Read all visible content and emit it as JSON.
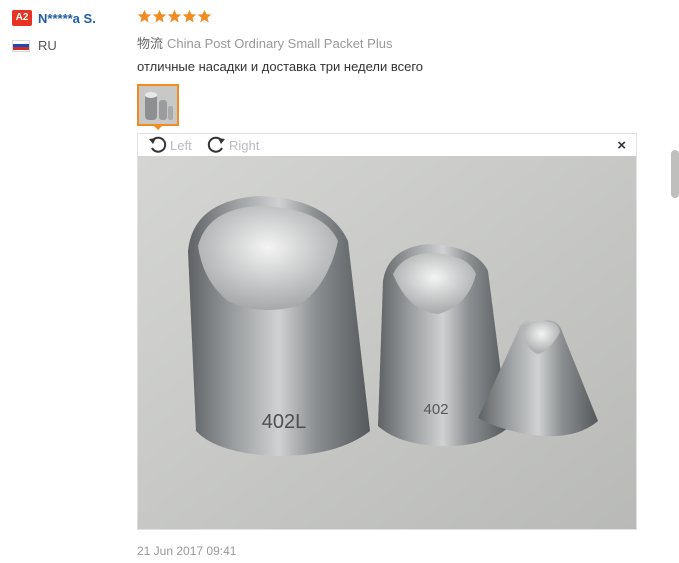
{
  "buyer": {
    "level_badge": "A2",
    "name": "N*****a S.",
    "country": "RU",
    "flag_colors": [
      "#ffffff",
      "#1c48b8",
      "#d52b1e"
    ]
  },
  "review": {
    "rating": 5,
    "star_color": "#f08c21",
    "shipping_label": "物流",
    "shipping_method": "China Post Ordinary Small Packet Plus",
    "text": "отличные насадки и доставка три недели всего",
    "date": "21 Jun 2017 09:41"
  },
  "viewer": {
    "rotate_left_label": "Left",
    "rotate_right_label": "Right",
    "close_label": "×",
    "photo": {
      "tips": [
        {
          "label": "402L"
        },
        {
          "label": "402"
        },
        {
          "label": ""
        }
      ]
    }
  },
  "colors": {
    "accent": "#f08c21",
    "link": "#1f5ea8",
    "badge": "#e83322"
  }
}
